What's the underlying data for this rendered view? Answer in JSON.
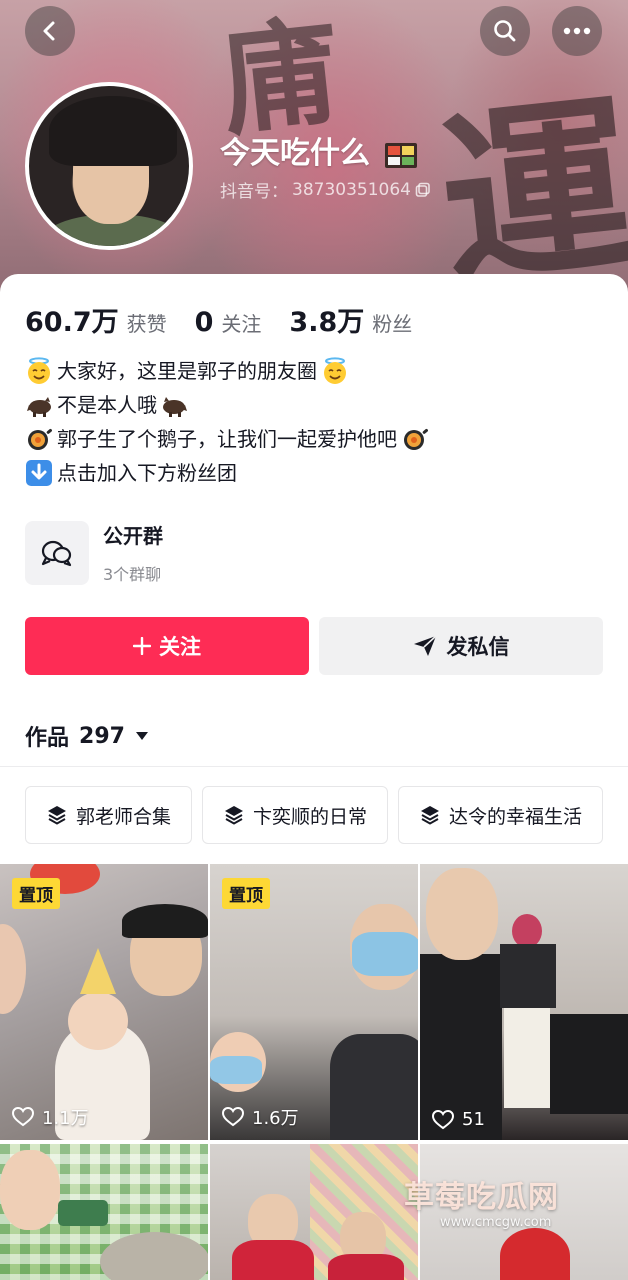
{
  "profile": {
    "name": "今天吃什么",
    "douyin_id_label": "抖音号：",
    "douyin_id": "38730351064"
  },
  "stats": [
    {
      "num": "60.7万",
      "label": "获赞"
    },
    {
      "num": "0",
      "label": "关注"
    },
    {
      "num": "3.8万",
      "label": "粉丝"
    }
  ],
  "bio": [
    {
      "text": "大家好，这里是郭子的朋友圈",
      "lead_icon": "halo-smile-emoji",
      "trail_icon": "halo-smile-emoji"
    },
    {
      "text": "不是本人哦",
      "lead_icon": "boar-emoji",
      "trail_icon": "boar-emoji"
    },
    {
      "text": "郭子生了个鹅子，让我们一起爱护他吧",
      "lead_icon": "pan-emoji",
      "trail_icon": "pan-emoji"
    },
    {
      "text": "点击加入下方粉丝团",
      "lead_icon": "down-arrow-emoji",
      "trail_icon": ""
    }
  ],
  "group": {
    "title": "公开群",
    "subtitle": "3个群聊"
  },
  "actions": {
    "follow_label": "关注",
    "message_label": "发私信"
  },
  "works": {
    "label": "作品",
    "count": "297"
  },
  "collections": [
    {
      "label": "郭老师合集"
    },
    {
      "label": "卞奕顺的日常"
    },
    {
      "label": "达令的幸福生活"
    }
  ],
  "videos": [
    {
      "pinned": true,
      "pin_label": "置顶",
      "likes": "1.1万"
    },
    {
      "pinned": true,
      "pin_label": "置顶",
      "likes": "1.6万"
    },
    {
      "pinned": false,
      "pin_label": "",
      "likes": "51"
    },
    {
      "pinned": false,
      "pin_label": "",
      "likes": ""
    },
    {
      "pinned": false,
      "pin_label": "",
      "likes": ""
    },
    {
      "pinned": false,
      "pin_label": "",
      "likes": ""
    }
  ],
  "watermark": {
    "text": "草莓吃瓜网",
    "url": "www.cmcgw.com"
  },
  "colors": {
    "accent": "#fe2c55",
    "pin_badge": "#fdd835"
  }
}
